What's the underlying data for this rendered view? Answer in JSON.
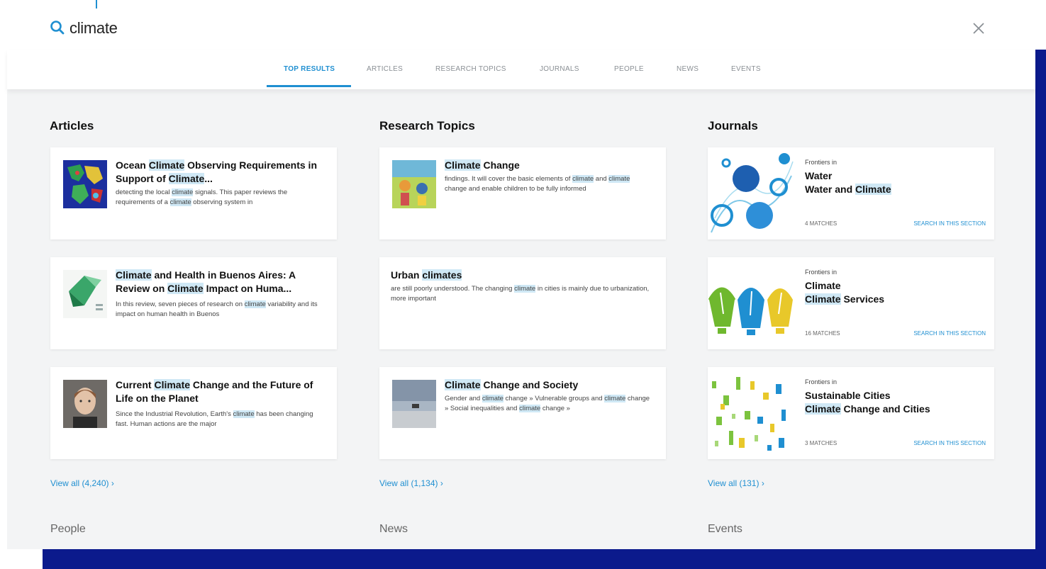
{
  "search": {
    "query": "climate"
  },
  "tabs": [
    {
      "label": "TOP RESULTS"
    },
    {
      "label": "ARTICLES"
    },
    {
      "label": "RESEARCH TOPICS"
    },
    {
      "label": "JOURNALS"
    },
    {
      "label": "PEOPLE"
    },
    {
      "label": "NEWS"
    },
    {
      "label": "EVENTS"
    }
  ],
  "sections": {
    "articles": {
      "title": "Articles",
      "view_all": "View all (4,240)",
      "items": [
        {
          "title_parts": [
            "Ocean ",
            "Climate",
            " Observing Requirements in Support of ",
            "Climate",
            "..."
          ],
          "body_parts": [
            "detecting the local ",
            "climate",
            " signals. This paper reviews the requirements of a ",
            "climate",
            " observing system in"
          ]
        },
        {
          "title_parts": [
            "Climate",
            " and Health in Buenos Aires: A Review on ",
            "Climate",
            " Impact on Huma..."
          ],
          "body_parts": [
            "In this review, seven pieces of research on ",
            "climate",
            " variability and its impact on human health in Buenos"
          ]
        },
        {
          "title_parts": [
            "Current ",
            "Climate",
            " Change and the Future of Life on the Planet"
          ],
          "body_parts": [
            "Since the Industrial Revolution, Earth's ",
            "climate",
            " has been changing fast. Human actions are the major"
          ]
        }
      ]
    },
    "research_topics": {
      "title": "Research Topics",
      "view_all": "View all (1,134)",
      "items": [
        {
          "title_parts": [
            "Climate",
            " Change"
          ],
          "body_parts": [
            "findings. It will cover the basic elements of ",
            "climate",
            " and ",
            "climate",
            " change and enable children to be fully informed"
          ]
        },
        {
          "title_parts": [
            "Urban ",
            "climates"
          ],
          "body_parts": [
            "are still poorly understood. The changing ",
            "climate",
            " in cities is mainly due to urbanization, more important"
          ]
        },
        {
          "title_parts": [
            "Climate",
            " Change and Society"
          ],
          "body_parts": [
            "Gender and ",
            "climate",
            " change » Vulnerable groups and ",
            "climate",
            " change » Social inequalities and ",
            "climate",
            " change »"
          ]
        }
      ]
    },
    "journals": {
      "title": "Journals",
      "view_all": "View all (131)",
      "items": [
        {
          "pre": "Frontiers in",
          "name_parts": [
            "Water"
          ],
          "sub_parts": [
            "Water and ",
            "Climate"
          ],
          "matches": "4 MATCHES",
          "search_label": "SEARCH IN THIS SECTION"
        },
        {
          "pre": "Frontiers in",
          "name_parts": [
            "Climate"
          ],
          "sub_parts": [
            "Climate",
            " Services"
          ],
          "matches": "16 MATCHES",
          "search_label": "SEARCH IN THIS SECTION"
        },
        {
          "pre": "Frontiers in",
          "name_parts": [
            "Sustainable Cities"
          ],
          "sub_parts": [
            "Climate",
            " Change and Cities"
          ],
          "matches": "3 MATCHES",
          "search_label": "SEARCH IN THIS SECTION"
        }
      ]
    }
  },
  "bottom_sections": [
    "People",
    "News",
    "Events"
  ],
  "colors": {
    "accent": "#1f8fd1",
    "highlight": "#cfe8f5",
    "navy": "#0b1a8c",
    "panel": "#f3f4f5"
  }
}
